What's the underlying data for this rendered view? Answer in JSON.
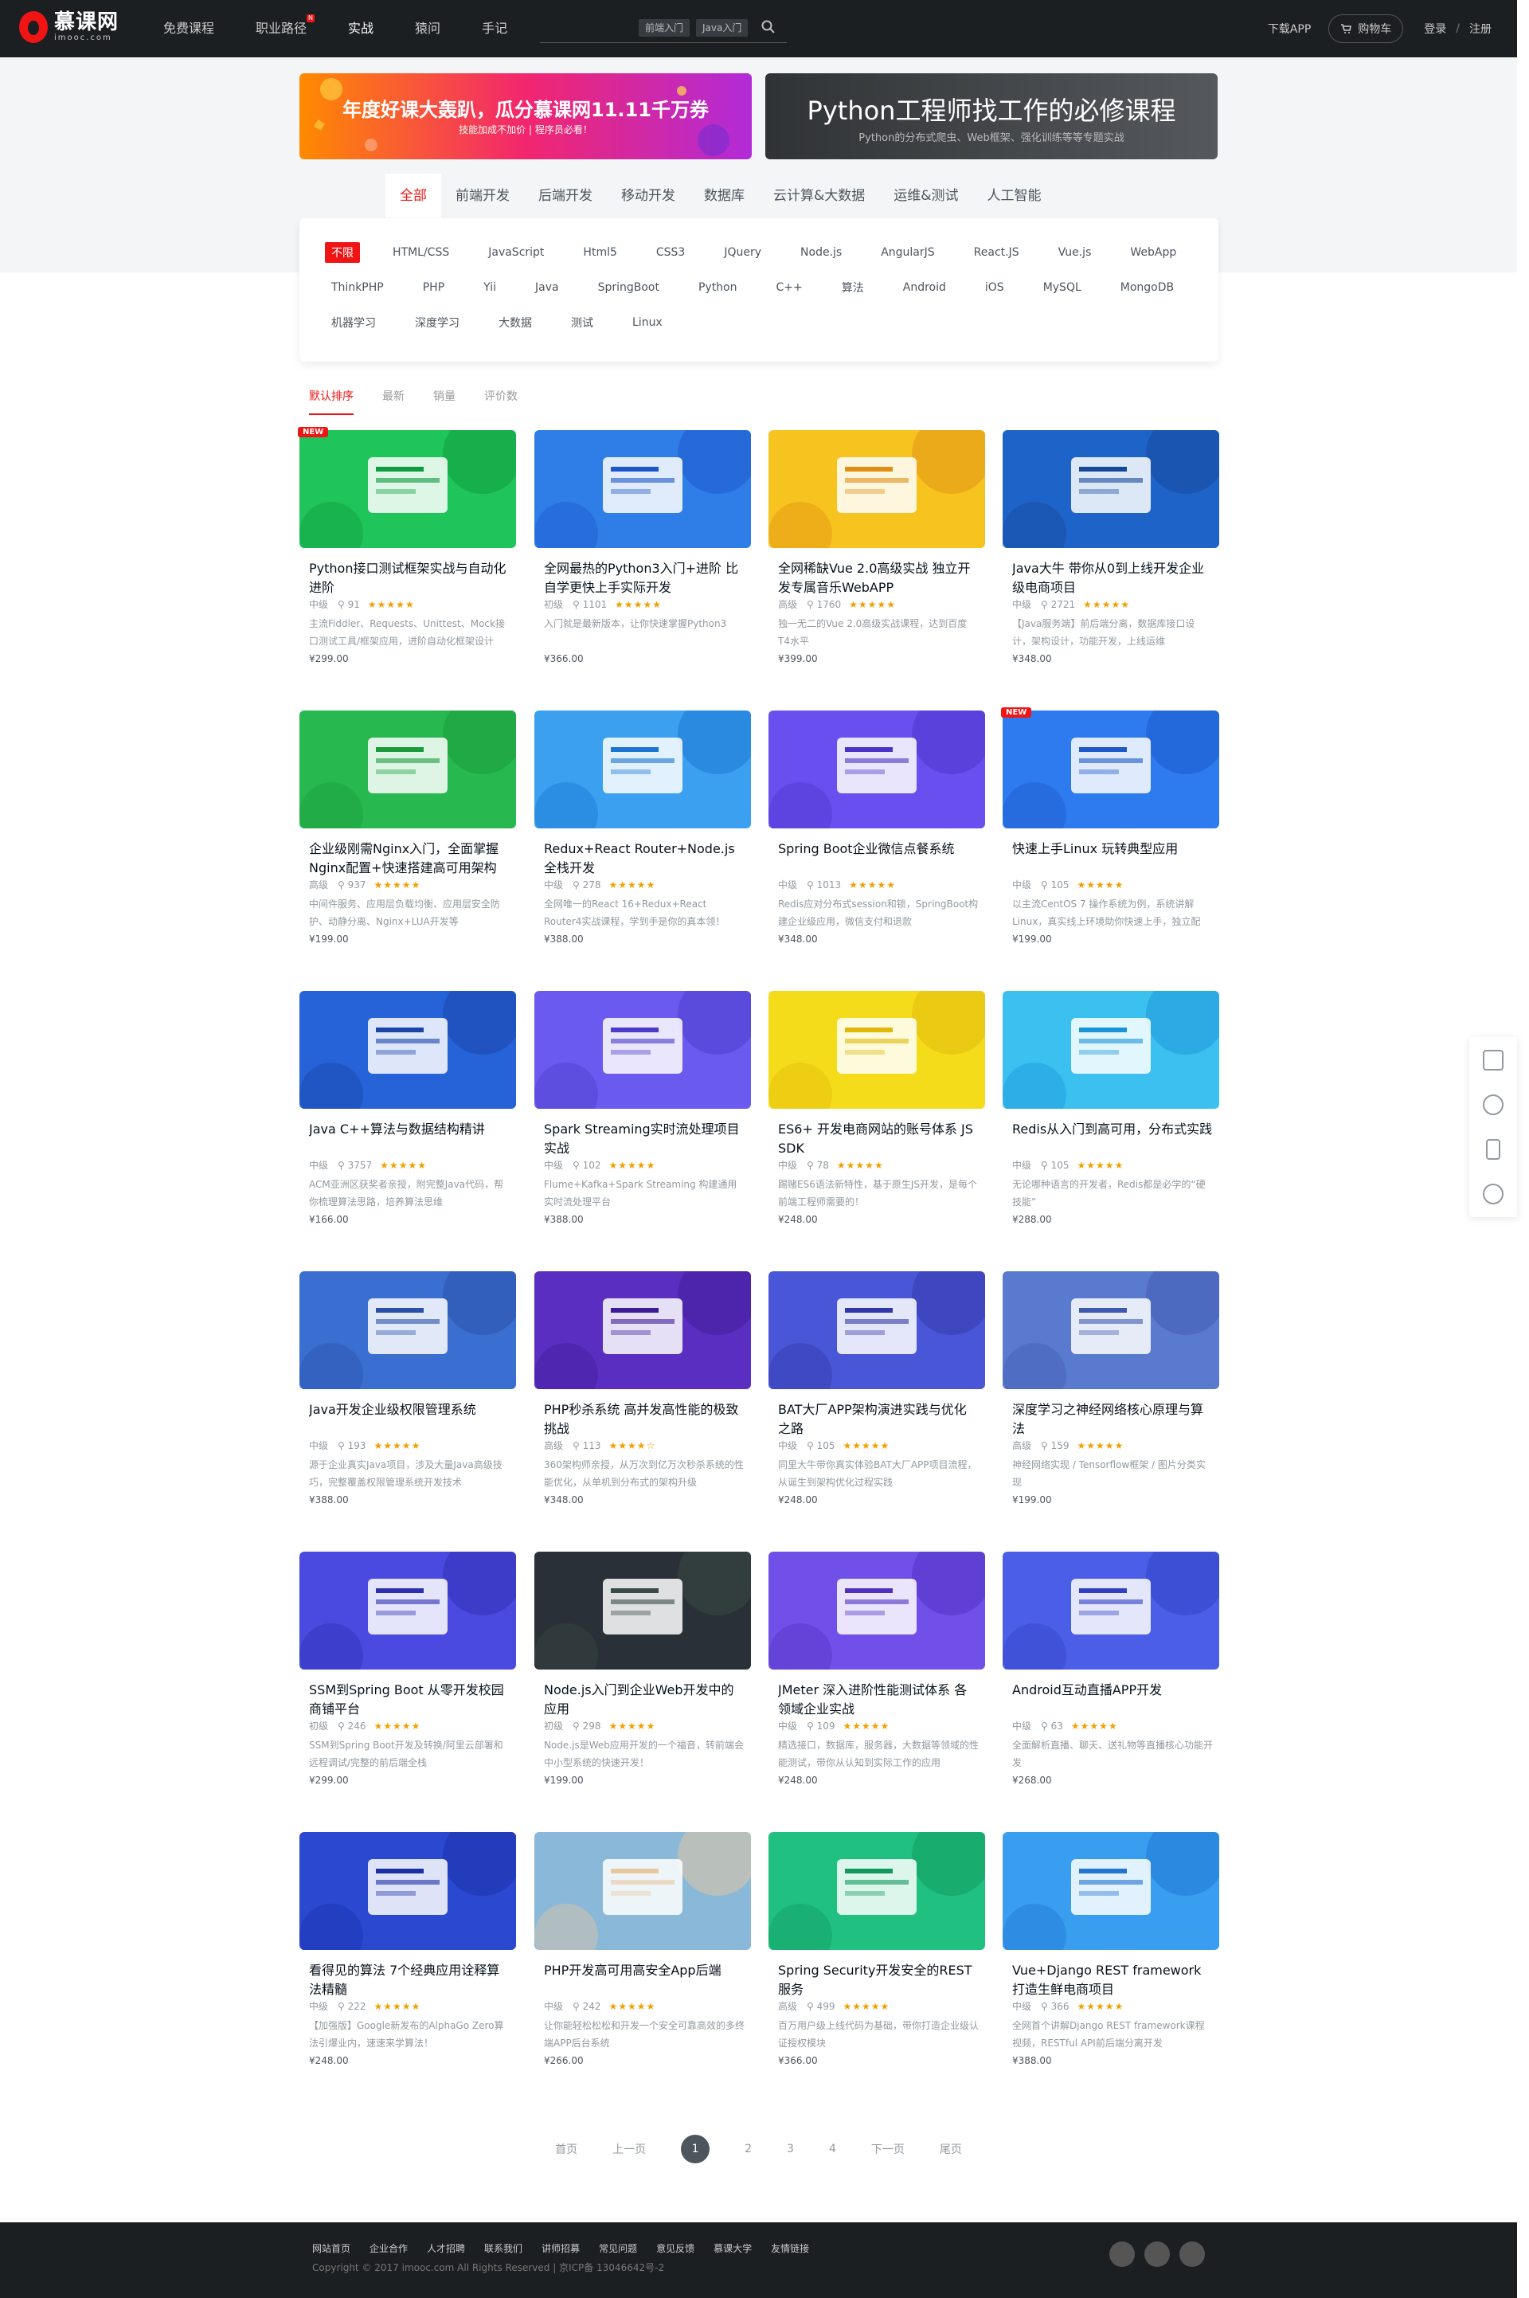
{
  "header": {
    "logo_cn": "慕课网",
    "logo_en": "imooc.com",
    "nav": [
      {
        "label": "免费课程"
      },
      {
        "label": "职业路径",
        "badge": "N"
      },
      {
        "label": "实战"
      },
      {
        "label": "猿问"
      },
      {
        "label": "手记"
      }
    ],
    "search_tags": [
      "前端入门",
      "Java入门"
    ],
    "download_app": "下载APP",
    "cart": "购物车",
    "login": "登录",
    "separator": "/",
    "register": "注册"
  },
  "banners": [
    {
      "title": "年度好课大轰趴，瓜分慕课网11.11千万券",
      "subtitle": "技能加成不加价 | 程序员必看！"
    },
    {
      "title": "Python工程师找工作的必修课程",
      "subtitle": "Python的分布式爬虫、Web框架、强化训练等等专题实战"
    }
  ],
  "categories": [
    "全部",
    "前端开发",
    "后端开发",
    "移动开发",
    "数据库",
    "云计算&大数据",
    "运维&测试",
    "人工智能"
  ],
  "tags": [
    [
      "不限",
      "HTML/CSS",
      "JavaScript",
      "Html5",
      "CSS3",
      "JQuery",
      "Node.js",
      "AngularJS",
      "React.JS",
      "Vue.js",
      "WebApp"
    ],
    [
      "ThinkPHP",
      "PHP",
      "Yii",
      "Java",
      "SpringBoot",
      "Python",
      "C++",
      "算法",
      "Android",
      "iOS",
      "MySQL",
      "MongoDB"
    ],
    [
      "机器学习",
      "深度学习",
      "大数据",
      "测试",
      "Linux"
    ]
  ],
  "sort": [
    "默认排序",
    "最新",
    "销量",
    "评价数"
  ],
  "courses": [
    {
      "title": "Python接口测试框架实战与自动化进阶",
      "level": "中级",
      "count": "91",
      "rating": 5,
      "desc": "主流Fiddler、Requests、Unittest、Mock接口测试工具/框架应用，进阶自动化框架设计",
      "price": "¥299.00",
      "badge": "NEW",
      "bg": "#1fc45a",
      "fg": "#0e9a3e"
    },
    {
      "title": "全网最热的Python3入门+进阶 比自学更快上手实际开发",
      "level": "初级",
      "count": "1101",
      "rating": 5,
      "desc": "入门就是最新版本，让你快速掌握Python3",
      "price": "¥366.00",
      "bg": "#2f7ee8",
      "fg": "#1c56c8"
    },
    {
      "title": "全网稀缺Vue 2.0高级实战 独立开发专属音乐WebAPP",
      "level": "高级",
      "count": "1760",
      "rating": 5,
      "desc": "独一无二的Vue 2.0高级实战课程，达到百度T4水平",
      "price": "¥399.00",
      "bg": "#f7c41f",
      "fg": "#e08f15"
    },
    {
      "title": "Java大牛 带你从0到上线开发企业级电商项目",
      "level": "中级",
      "count": "2721",
      "rating": 5,
      "desc": "【Java服务端】前后端分离，数据库接口设计，架构设计，功能开发，上线运维",
      "price": "¥348.00",
      "bg": "#1e63c8",
      "fg": "#16489a"
    },
    {
      "title": "企业级刚需Nginx入门，全面掌握Nginx配置+快速搭建高可用架构",
      "level": "高级",
      "count": "937",
      "rating": 5,
      "desc": "中间件服务、应用层负载均衡、应用层安全防护、动静分离、Nginx+LUA开发等",
      "price": "¥199.00",
      "bg": "#27b84f",
      "fg": "#1b9a3c"
    },
    {
      "title": "Redux+React Router+Node.js全栈开发",
      "level": "中级",
      "count": "278",
      "rating": 5,
      "desc": "全网唯一的React 16+Redux+React Router4实战课程，学到手是你的真本领！",
      "price": "¥388.00",
      "bg": "#3aa0ef",
      "fg": "#1a74d0"
    },
    {
      "title": "Spring Boot企业微信点餐系统",
      "level": "中级",
      "count": "1013",
      "rating": 5,
      "desc": "Redis应对分布式session和锁，SpringBoot构建企业级应用，微信支付和退款",
      "price": "¥348.00",
      "bg": "#6a4ff0",
      "fg": "#4b33c8"
    },
    {
      "title": "快速上手Linux 玩转典型应用",
      "level": "中级",
      "count": "105",
      "rating": 5,
      "desc": "以主流CentOS 7 操作系统为例，系统讲解Linux，真实线上环境助你快速上手，独立配置...",
      "price": "¥199.00",
      "badge": "NEW",
      "bg": "#2d7bef",
      "fg": "#1c58c8"
    },
    {
      "title": "Java C++算法与数据结构精讲",
      "level": "中级",
      "count": "3757",
      "rating": 5,
      "desc": "ACM亚洲区获奖者亲授，附完整Java代码，帮你梳理算法思路，培养算法思维",
      "price": "¥166.00",
      "bg": "#2662d8",
      "fg": "#1a44a8"
    },
    {
      "title": "Spark Streaming实时流处理项目实战",
      "level": "中级",
      "count": "102",
      "rating": 5,
      "desc": "Flume+Kafka+Spark Streaming 构建通用实时流处理平台",
      "price": "¥388.00",
      "bg": "#6a5af0",
      "fg": "#4a3cc8"
    },
    {
      "title": "ES6+ 开发电商网站的账号体系 JS SDK",
      "level": "中级",
      "count": "78",
      "rating": 5,
      "desc": "踢赌ES6语法新特性，基于原生JS开发，是每个前端工程师需要的！",
      "price": "¥248.00",
      "bg": "#f5dc1a",
      "fg": "#e0b80a"
    },
    {
      "title": "Redis从入门到高可用，分布式实践",
      "level": "中级",
      "count": "105",
      "rating": 5,
      "desc": "无论哪种语言的开发者，Redis都是必学的“硬技能”",
      "price": "¥288.00",
      "bg": "#3cc0f0",
      "fg": "#1a94d8"
    },
    {
      "title": "Java开发企业级权限管理系统",
      "level": "中级",
      "count": "193",
      "rating": 5,
      "desc": "源于企业真实Java项目，涉及大量Java高级技巧，完整覆盖权限管理系统开发技术",
      "price": "¥388.00",
      "bg": "#3a6ed0",
      "fg": "#2a50a8"
    },
    {
      "title": "PHP秒杀系统 高并发高性能的极致挑战",
      "level": "高级",
      "count": "113",
      "rating": 4,
      "desc": "360架构师亲授，从万次到亿万次秒杀系统的性能优化，从单机到分布式的架构升级",
      "price": "¥348.00",
      "bg": "#5a2ec0",
      "fg": "#3e1c98"
    },
    {
      "title": "BAT大厂APP架构演进实践与优化之路",
      "level": "中级",
      "count": "105",
      "rating": 5,
      "desc": "同里大牛带你真实体验BAT大厂APP项目流程，从诞生到架构优化过程实践",
      "price": "¥248.00",
      "bg": "#4a56d8",
      "fg": "#3238a8"
    },
    {
      "title": "深度学习之神经网络核心原理与算法",
      "level": "高级",
      "count": "159",
      "rating": 5,
      "desc": "神经网络实现 / Tensorflow框架 / 图片分类实现",
      "price": "¥199.00",
      "bg": "#5a7ad0",
      "fg": "#3e5ab0"
    },
    {
      "title": "SSM到Spring Boot 从零开发校园商铺平台",
      "level": "初级",
      "count": "246",
      "rating": 5,
      "desc": "SSM到Spring Boot开发及转换/阿里云部署和远程调试/完整的前后端全栈",
      "price": "¥299.00",
      "bg": "#4a4ae0",
      "fg": "#2e2eb0"
    },
    {
      "title": "Node.js入门到企业Web开发中的应用",
      "level": "初级",
      "count": "298",
      "rating": 5,
      "desc": "Node.js是Web应用开发的一个福音，转前端会中小型系统的快速开发！",
      "price": "¥199.00",
      "bg": "#2a3038",
      "fg": "#3a4a44"
    },
    {
      "title": "JMeter 深入进阶性能测试体系 各领域企业实战",
      "level": "中级",
      "count": "109",
      "rating": 5,
      "desc": "精选接口，数据库，服务器，大数据等领域的性能测试，带你从认知到实际工作的应用",
      "price": "¥248.00",
      "bg": "#7050e8",
      "fg": "#5030c0"
    },
    {
      "title": "Android互动直播APP开发",
      "level": "中级",
      "count": "63",
      "rating": 5,
      "desc": "全面解析直播、聊天、送礼物等直播核心功能开发",
      "price": "¥268.00",
      "bg": "#4a5ee8",
      "fg": "#3040c0"
    },
    {
      "title": "看得见的算法 7个经典应用诠释算法精髓",
      "level": "中级",
      "count": "222",
      "rating": 5,
      "desc": "【加强版】Google新发布的AlphaGo Zero算法引爆业内，速速来学算法！",
      "price": "¥248.00",
      "bg": "#2a48d0",
      "fg": "#1a30a8"
    },
    {
      "title": "PHP开发高可用高安全App后端",
      "level": "中级",
      "count": "242",
      "rating": 5,
      "desc": "让你能轻松松松和开发一个安全可靠高效的多终端APP后台系统",
      "price": "¥266.00",
      "bg": "#8ab8d8",
      "fg": "#e8c8a0"
    },
    {
      "title": "Spring Security开发安全的REST服务",
      "level": "高级",
      "count": "499",
      "rating": 5,
      "desc": "百万用户级上线代码为基础，带你打造企业级认证授权模块",
      "price": "¥366.00",
      "bg": "#20c080",
      "fg": "#12985e"
    },
    {
      "title": "Vue+Django REST framework 打造生鲜电商项目",
      "level": "中级",
      "count": "366",
      "rating": 5,
      "desc": "全网首个讲解Django REST framework课程视频，RESTful API前后端分离开发",
      "price": "¥388.00",
      "bg": "#3a9ef0",
      "fg": "#1e74d0"
    }
  ],
  "pager": {
    "first": "首页",
    "prev": "上一页",
    "pages": [
      "1",
      "2",
      "3",
      "4"
    ],
    "current": "1",
    "next": "下一页",
    "last": "尾页"
  },
  "footer": {
    "links": [
      "网站首页",
      "企业合作",
      "人才招聘",
      "联系我们",
      "讲师招募",
      "常见问题",
      "意见反馈",
      "慕课大学",
      "友情链接"
    ],
    "copyright": "Copyright © 2017 imooc.com All Rights Reserved | 京ICP备 13046642号-2"
  },
  "colors": {
    "accent": "#f01414",
    "dark": "#1c1f21",
    "star": "#f0a000"
  }
}
